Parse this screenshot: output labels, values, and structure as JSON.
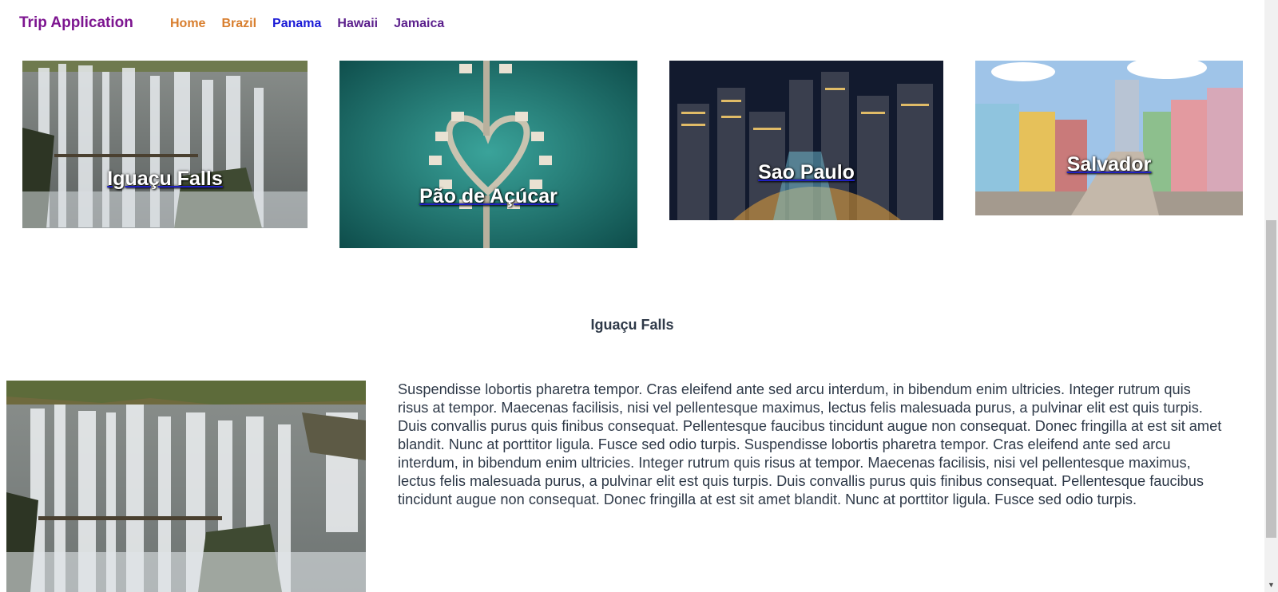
{
  "header": {
    "brand": "Trip Application",
    "nav": [
      {
        "label": "Home",
        "color": "#d87e2e"
      },
      {
        "label": "Brazil",
        "color": "#d87e2e"
      },
      {
        "label": "Panama",
        "color": "#1a1ad6"
      },
      {
        "label": "Hawaii",
        "color": "#5b1f8c"
      },
      {
        "label": "Jamaica",
        "color": "#5b1f8c"
      }
    ]
  },
  "cards": [
    {
      "title": "Iguaçu Falls"
    },
    {
      "title": "Pão de Açúcar"
    },
    {
      "title": "Sao Paulo"
    },
    {
      "title": "Salvador"
    }
  ],
  "detail": {
    "title": "Iguaçu Falls",
    "body": "Suspendisse lobortis pharetra tempor. Cras eleifend ante sed arcu interdum, in bibendum enim ultricies. Integer rutrum quis risus at tempor. Maecenas facilisis, nisi vel pellentesque maximus, lectus felis malesuada purus, a pulvinar elit est quis turpis. Duis convallis purus quis finibus consequat. Pellentesque faucibus tincidunt augue non consequat. Donec fringilla at est sit amet blandit. Nunc at porttitor ligula. Fusce sed odio turpis. Suspendisse lobortis pharetra tempor. Cras eleifend ante sed arcu interdum, in bibendum enim ultricies. Integer rutrum quis risus at tempor. Maecenas facilisis, nisi vel pellentesque maximus, lectus felis malesuada purus, a pulvinar elit est quis turpis. Duis convallis purus quis finibus consequat. Pellentesque faucibus tincidunt augue non consequat. Donec fringilla at est sit amet blandit. Nunc at porttitor ligula. Fusce sed odio turpis."
  }
}
